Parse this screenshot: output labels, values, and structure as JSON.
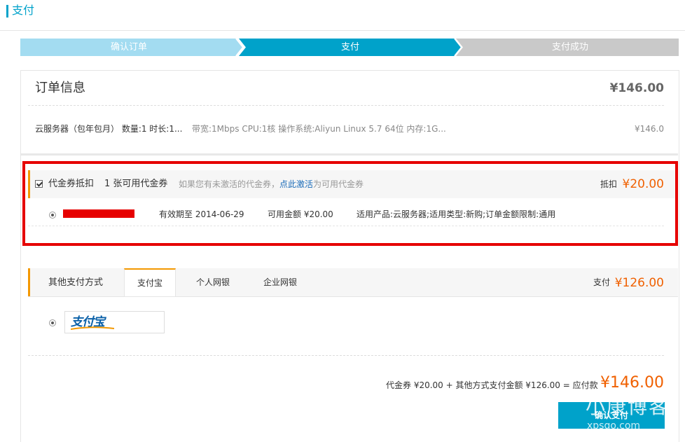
{
  "header": {
    "title": "支付"
  },
  "steps": [
    {
      "label": "确认订单"
    },
    {
      "label": "支付"
    },
    {
      "label": "支付成功"
    }
  ],
  "order": {
    "title": "订单信息",
    "total": "¥146.00",
    "item_name": "云服务器（包年包月） 数量:1 时长:1...",
    "item_specs": "带宽:1Mbps CPU:1核 操作系统:Aliyun Linux 5.7 64位 内存:1G...",
    "item_price": "¥146.0"
  },
  "coupon": {
    "label": "代金券抵扣",
    "count": "1 张可用代金券",
    "hint_before": "如果您有未激活的代金券，",
    "hint_link": "点此激活",
    "hint_after": "为可用代金券",
    "deduct_label": "抵扣",
    "deduct_amount": "¥20.00",
    "expiry": "有效期至 2014-06-29",
    "available": "可用金额 ¥20.00",
    "scope": "适用产品:云服务器;适用类型:新购;订单金额限制:通用"
  },
  "payment": {
    "label": "其他支付方式",
    "tabs": [
      {
        "label": "支付宝"
      },
      {
        "label": "个人网银"
      },
      {
        "label": "企业网银"
      }
    ],
    "pay_word": "支付",
    "pay_amount": "¥126.00",
    "alipay_logo": "支付宝"
  },
  "summary": {
    "text": "代金券 ¥20.00 + 其他方式支付金额 ¥126.00 = 应付款",
    "final_amount": "¥146.00",
    "confirm_label": "确认支付"
  },
  "watermark": {
    "main": "小康博客",
    "sub": "xpsqo.com"
  },
  "colors": {
    "accent": "#00a2ca",
    "orange": "#f06000",
    "highlight": "#e60000"
  }
}
